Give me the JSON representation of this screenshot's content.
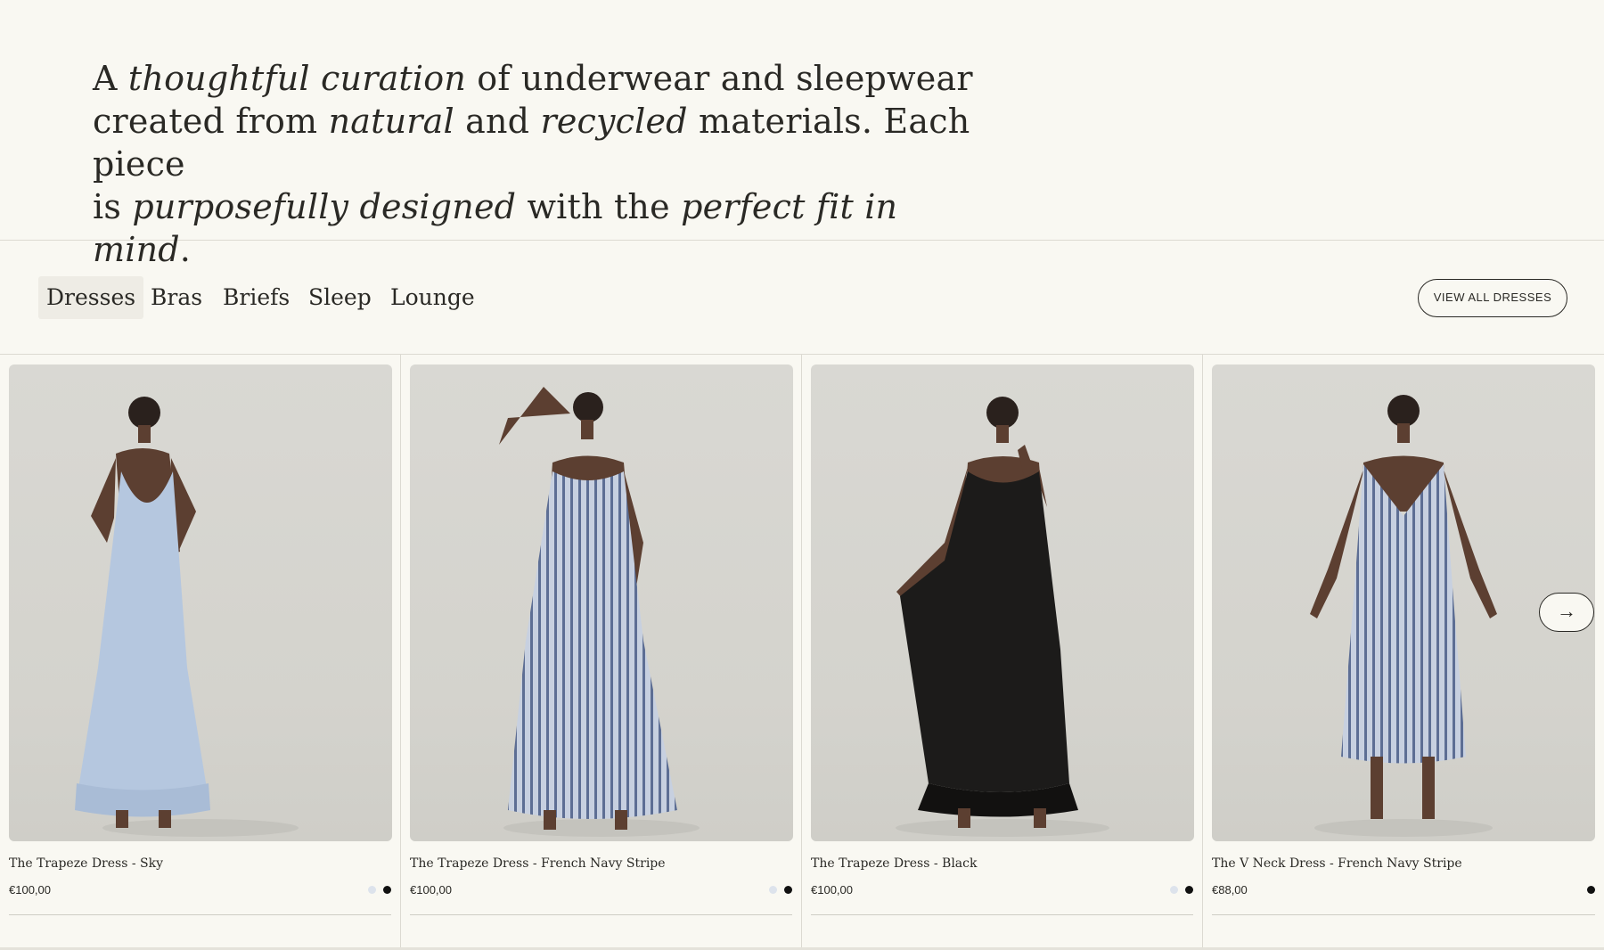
{
  "hero": {
    "t1": "A ",
    "t2": "thoughtful curation",
    "t3": " of underwear and sleepwear",
    "t4": "created from ",
    "t5": "natural",
    "t6": " and ",
    "t7": "recycled",
    "t8": " materials. Each piece",
    "t9": "is ",
    "t10": "purposefully designed",
    "t11": " with the ",
    "t12": "perfect fit in mind",
    "t13": "."
  },
  "tabs": [
    {
      "label": "Dresses",
      "active": true
    },
    {
      "label": "Bras"
    },
    {
      "label": "Briefs"
    },
    {
      "label": "Sleep"
    },
    {
      "label": "Lounge"
    }
  ],
  "view_all_label": "VIEW ALL DRESSES",
  "next_arrow": "→",
  "products": [
    {
      "name": "The Trapeze Dress - Sky",
      "price": "€100,00",
      "swatches": [
        "#dde3ec",
        "#111111"
      ],
      "dress_color": "#b5c7df"
    },
    {
      "name": "The Trapeze Dress - French Navy Stripe",
      "price": "€100,00",
      "swatches": [
        "#dde3ec",
        "#111111"
      ],
      "dress_color": "#a9b6cf"
    },
    {
      "name": "The Trapeze Dress - Black",
      "price": "€100,00",
      "swatches": [
        "#dde3ec",
        "#111111"
      ],
      "dress_color": "#1c1b1a"
    },
    {
      "name": "The V Neck Dress - French Navy Stripe",
      "price": "€88,00",
      "swatches": [
        "#111111"
      ],
      "dress_color": "#a9b6cf"
    }
  ]
}
